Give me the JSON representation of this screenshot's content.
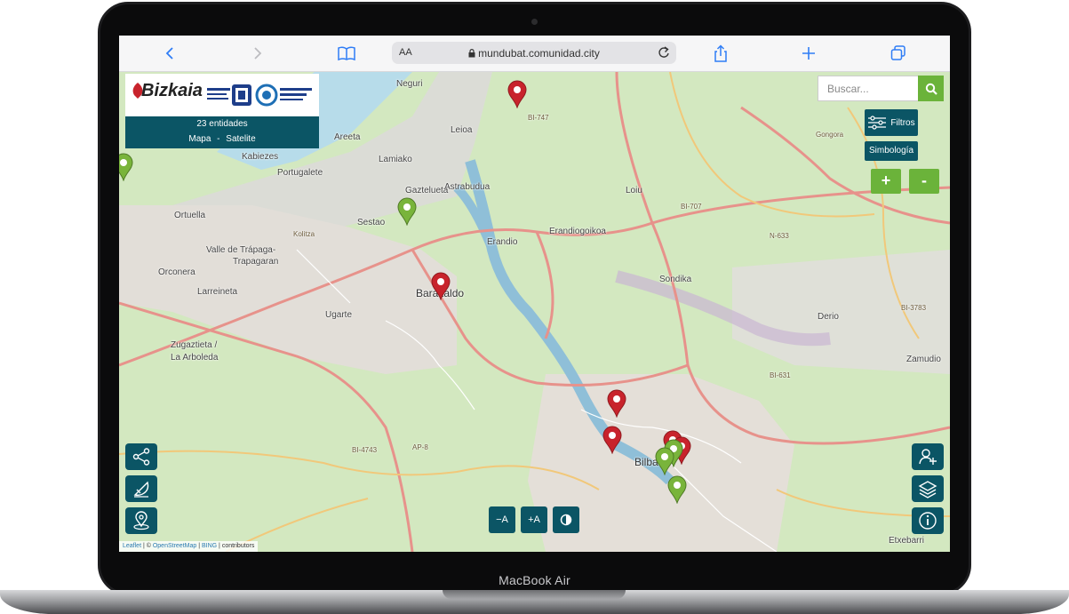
{
  "device": {
    "model_label": "MacBook Air"
  },
  "browser": {
    "aa_label": "AA",
    "url": "mundubat.comunidad.city"
  },
  "map_header": {
    "logo_text": "Bizkaia",
    "entities_count": "23 entidades",
    "map_link": "Mapa",
    "separator": "-",
    "satellite_link": "Satelite"
  },
  "search": {
    "placeholder": "Buscar..."
  },
  "controls": {
    "filters_label": "Filtros",
    "symbology_label": "Simbología",
    "zoom_in": "+",
    "zoom_out": "-",
    "font_smaller": "−A",
    "font_larger": "+A"
  },
  "attribution": {
    "leaflet": "Leaflet",
    "sep1": " | © ",
    "osm": "OpenStreetMap",
    "sep2": " | ",
    "bing": "BING",
    "sep3": " | contributors"
  },
  "places": [
    {
      "id": "neguri",
      "label": "Neguri",
      "cls": ""
    },
    {
      "id": "leioa",
      "label": "Leioa",
      "cls": ""
    },
    {
      "id": "areeta",
      "label": "Areeta",
      "cls": ""
    },
    {
      "id": "lamiako",
      "label": "Lamiako",
      "cls": ""
    },
    {
      "id": "kabiezes",
      "label": "Kabiezes",
      "cls": ""
    },
    {
      "id": "portugalete",
      "label": "Portugalete",
      "cls": ""
    },
    {
      "id": "astrabudua",
      "label": "Astrabudua",
      "cls": ""
    },
    {
      "id": "sestao",
      "label": "Sestao",
      "cls": ""
    },
    {
      "id": "erandio",
      "label": "Erandio",
      "cls": ""
    },
    {
      "id": "erandiogoikoa",
      "label": "Erandiogoikoa",
      "cls": ""
    },
    {
      "id": "ortuella",
      "label": "Ortuella",
      "cls": ""
    },
    {
      "id": "valle",
      "label": "Valle de Trápaga-",
      "cls": ""
    },
    {
      "id": "trapagaran",
      "label": "Trapagaran",
      "cls": ""
    },
    {
      "id": "barakaldo",
      "label": "Barakaldo",
      "cls": "big"
    },
    {
      "id": "orconera",
      "label": "Orconera",
      "cls": ""
    },
    {
      "id": "larreineta",
      "label": "Larreineta",
      "cls": ""
    },
    {
      "id": "ugarte",
      "label": "Ugarte",
      "cls": ""
    },
    {
      "id": "zugaztieta",
      "label": "Zugaztieta /",
      "cls": ""
    },
    {
      "id": "arboleda",
      "label": "La Arboleda",
      "cls": ""
    },
    {
      "id": "sondika",
      "label": "Sondika",
      "cls": ""
    },
    {
      "id": "derio",
      "label": "Derio",
      "cls": ""
    },
    {
      "id": "zamudio",
      "label": "Zamudio",
      "cls": ""
    },
    {
      "id": "bilbao",
      "label": "Bilbao",
      "cls": "big"
    },
    {
      "id": "etxebarri",
      "label": "Etxebarri",
      "cls": ""
    },
    {
      "id": "loiu",
      "label": "Loiu",
      "cls": ""
    },
    {
      "id": "gaztelueta",
      "label": "Gaztelueta",
      "cls": ""
    },
    {
      "id": "bi747",
      "label": "BI-747",
      "cls": "small"
    },
    {
      "id": "bi707",
      "label": "BI-707",
      "cls": "small"
    },
    {
      "id": "n633",
      "label": "N-633",
      "cls": "small"
    },
    {
      "id": "bi631",
      "label": "BI-631",
      "cls": "small"
    },
    {
      "id": "bi3783",
      "label": "BI-3783",
      "cls": "small"
    },
    {
      "id": "bi4743",
      "label": "BI-4743",
      "cls": "small"
    },
    {
      "id": "ap8",
      "label": "AP-8",
      "cls": "small"
    },
    {
      "id": "kolitza",
      "label": "Kolitza",
      "cls": "small"
    },
    {
      "id": "gongora",
      "label": "Gongora",
      "cls": "small"
    }
  ],
  "markers": [
    {
      "color": "red"
    },
    {
      "color": "green"
    },
    {
      "color": "green"
    },
    {
      "color": "red"
    },
    {
      "color": "red"
    },
    {
      "color": "red"
    },
    {
      "color": "red"
    },
    {
      "color": "red"
    },
    {
      "color": "green"
    },
    {
      "color": "green"
    },
    {
      "color": "green"
    }
  ],
  "colors": {
    "brand": "#0b5565",
    "accent": "#6bb33a",
    "marker_red": "#c8232c",
    "marker_green": "#79b43b"
  }
}
